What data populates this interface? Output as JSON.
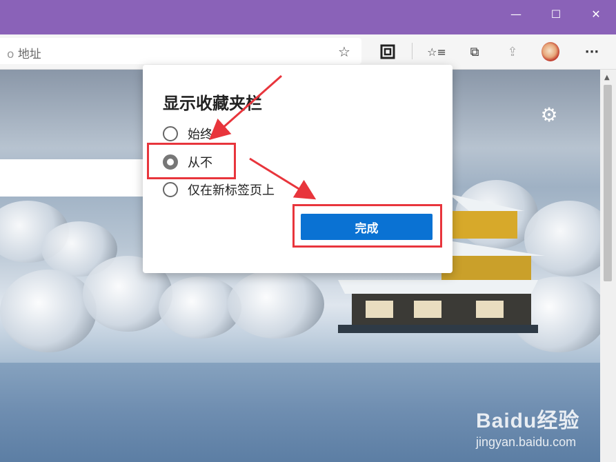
{
  "window": {
    "minimize_glyph": "—",
    "maximize_glyph": "☐",
    "close_glyph": "✕",
    "accent": "#8a62b8"
  },
  "toolbar": {
    "address_text": "地址",
    "address_prefix": "o",
    "favorite_star_icon": "☆",
    "collections_icon": "⧉",
    "favorites_icon": "☆≡",
    "share_icon": "⇪",
    "more_glyph": "···"
  },
  "popup": {
    "title": "显示收藏夹栏",
    "options": [
      {
        "label": "始终",
        "checked": false
      },
      {
        "label": "从不",
        "checked": true
      },
      {
        "label": "仅在新标签页上",
        "checked": false
      }
    ],
    "done_label": "完成",
    "done_color": "#0a72d3"
  },
  "annotation": {
    "color": "#e8353c"
  },
  "watermark": {
    "brand": "Baidu经验",
    "url": "jingyan.baidu.com"
  }
}
